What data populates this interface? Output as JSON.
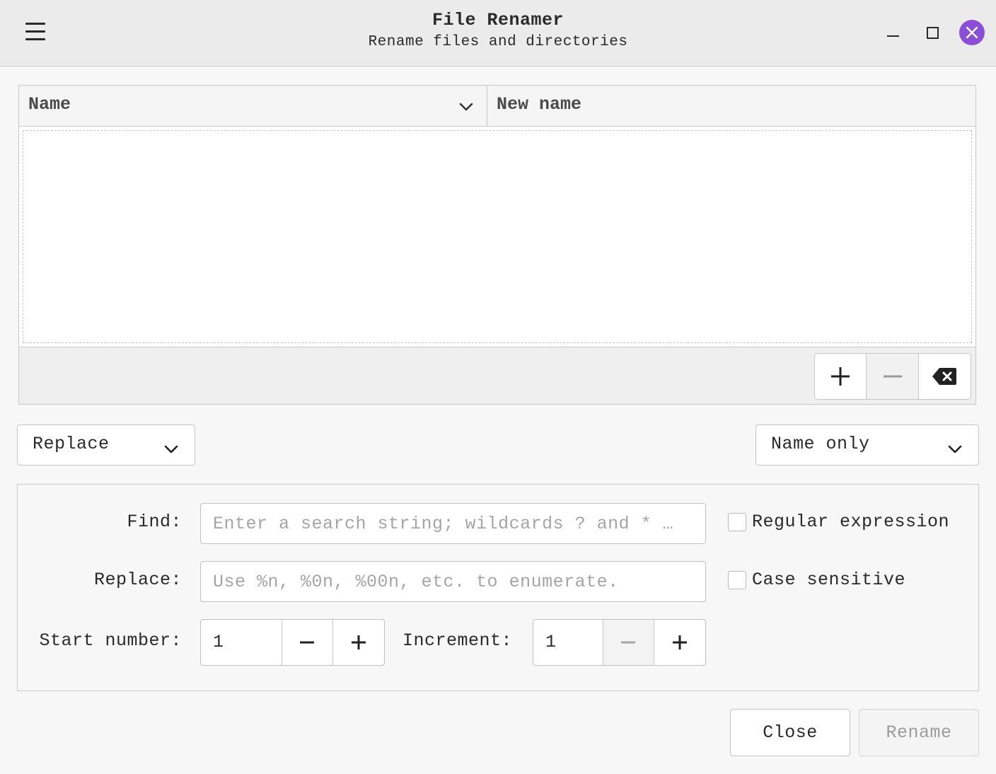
{
  "window": {
    "title": "File Renamer",
    "subtitle": "Rename files and directories",
    "accent_color": "#8a4fd6"
  },
  "file_list": {
    "columns": [
      {
        "label": "Name",
        "sortable": true
      },
      {
        "label": "New name"
      }
    ],
    "rows": [],
    "buttons": {
      "add_icon": "plus-icon",
      "remove_icon": "minus-icon",
      "clear_icon": "backspace-icon"
    }
  },
  "mode_select": {
    "selected": "Replace"
  },
  "scope_select": {
    "selected": "Name only"
  },
  "options": {
    "find_label": "Find:",
    "find_placeholder": "Enter a search string; wildcards ? and * …",
    "find_value": "",
    "replace_label": "Replace:",
    "replace_placeholder": "Use %n, %0n, %00n, etc. to enumerate.",
    "replace_value": "",
    "regex_label": "Regular expression",
    "regex_checked": false,
    "case_label": "Case sensitive",
    "case_checked": false,
    "start_label": "Start number:",
    "start_value": "1",
    "increment_label": "Increment:",
    "increment_value": "1"
  },
  "footer": {
    "close_label": "Close",
    "rename_label": "Rename"
  }
}
